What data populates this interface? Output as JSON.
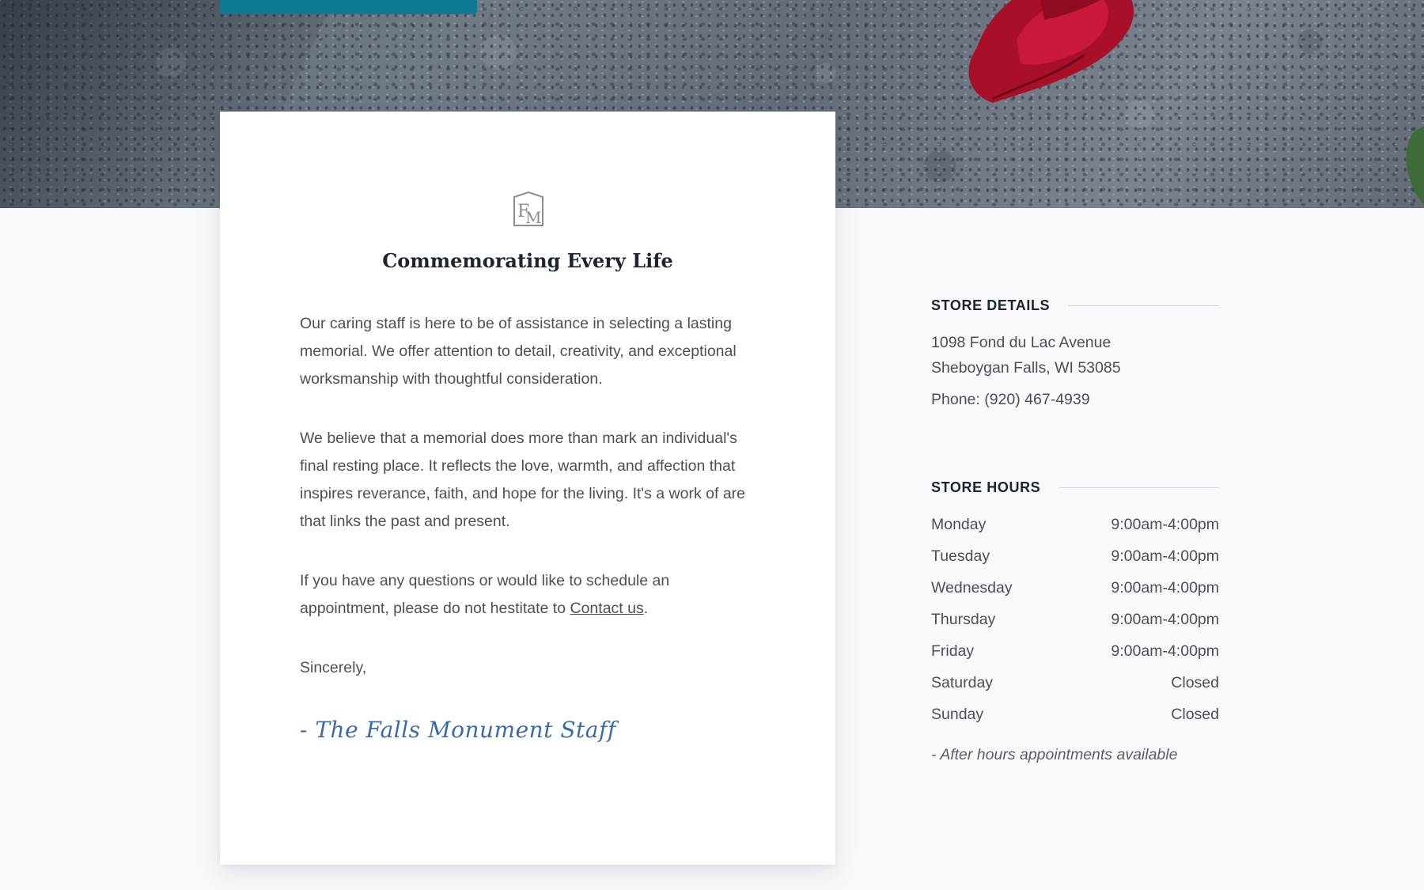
{
  "hero": {
    "button_label": ""
  },
  "card": {
    "logo_icon": "fm-monogram-icon",
    "title": "Commemorating Every Life",
    "paragraph_1": "Our caring staff is here to be of assistance in selecting a lasting memorial. We offer attention to detail, creativity, and exceptional worksmanship with thoughtful consideration.",
    "paragraph_2": "We believe that a memorial does more than mark an individual's final resting place. It reflects the love, warmth, and affection that inspires reverance, faith, and hope for the living. It's a work of are that links the past and present.",
    "paragraph_3_prefix": "If you have any questions or would like to schedule an appointment, please do not hestitate to ",
    "contact_link": "Contact us",
    "paragraph_3_suffix": ".",
    "closing": "Sincerely,",
    "signature": "- The Falls Monument Staff"
  },
  "store_details": {
    "heading": "STORE DETAILS",
    "address_line_1": "1098 Fond du Lac Avenue",
    "address_line_2": "Sheboygan Falls, WI 53085",
    "phone": "Phone: (920) 467-4939"
  },
  "store_hours": {
    "heading": "STORE HOURS",
    "days": [
      {
        "day": "Monday",
        "hours": "9:00am-4:00pm"
      },
      {
        "day": "Tuesday",
        "hours": "9:00am-4:00pm"
      },
      {
        "day": "Wednesday",
        "hours": "9:00am-4:00pm"
      },
      {
        "day": "Thursday",
        "hours": "9:00am-4:00pm"
      },
      {
        "day": "Friday",
        "hours": "9:00am-4:00pm"
      },
      {
        "day": "Saturday",
        "hours": "Closed"
      },
      {
        "day": "Sunday",
        "hours": "Closed"
      }
    ],
    "note": "- After hours appointments available"
  },
  "colors": {
    "accent_button": "#0e7b93",
    "signature": "#3b6aa8",
    "heading": "#1b2230"
  }
}
